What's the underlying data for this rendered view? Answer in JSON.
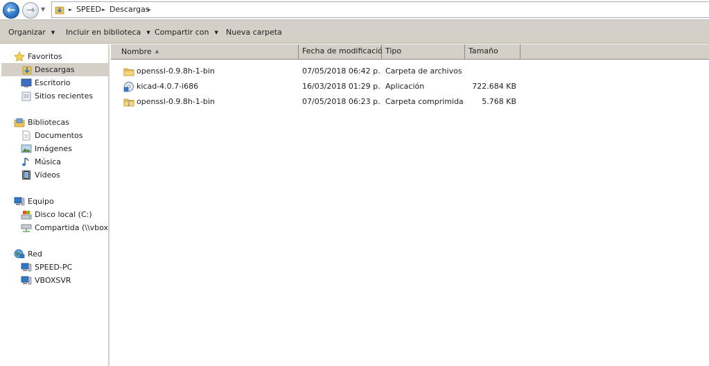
{
  "address": {
    "crumbs": [
      "SPEED",
      "Descargas"
    ]
  },
  "toolbar": {
    "organizar": "Organizar",
    "incluir": "Incluir en biblioteca",
    "compartir": "Compartir con",
    "nueva_carpeta": "Nueva carpeta"
  },
  "sidebar": {
    "favoritos": {
      "label": "Favoritos",
      "items": [
        "Descargas",
        "Escritorio",
        "Sitios recientes"
      ]
    },
    "bibliotecas": {
      "label": "Bibliotecas",
      "items": [
        "Documentos",
        "Imágenes",
        "Música",
        "Vídeos"
      ]
    },
    "equipo": {
      "label": "Equipo",
      "items": [
        "Disco local (C:)",
        "Compartida (\\\\vboxsrv"
      ]
    },
    "red": {
      "label": "Red",
      "items": [
        "SPEED-PC",
        "VBOXSVR"
      ]
    }
  },
  "columns": {
    "nombre": "Nombre",
    "fecha": "Fecha de modificación",
    "tipo": "Tipo",
    "tamano": "Tamaño"
  },
  "files": [
    {
      "name": "openssl-0.9.8h-1-bin",
      "date": "07/05/2018 06:42 p...",
      "type": "Carpeta de archivos",
      "size": "",
      "icon": "folder-icon"
    },
    {
      "name": "kicad-4.0.7-i686",
      "date": "16/03/2018 01:29 p...",
      "type": "Aplicación",
      "size": "722.684 KB",
      "icon": "installer-icon"
    },
    {
      "name": "openssl-0.9.8h-1-bin",
      "date": "07/05/2018 06:23 p...",
      "type": "Carpeta comprimida...",
      "size": "5.768 KB",
      "icon": "zip-folder-icon"
    }
  ],
  "colors": {
    "chrome": "#d4d0c8",
    "back_button": "#2f79c9",
    "folder": "#e8c15a"
  }
}
